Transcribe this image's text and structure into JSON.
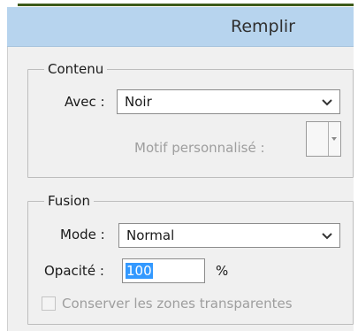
{
  "window": {
    "title": "Remplir"
  },
  "contenu": {
    "legend": "Contenu",
    "avec_label": "Avec :",
    "avec_value": "Noir",
    "motif_label": "Motif personnalisé :"
  },
  "fusion": {
    "legend": "Fusion",
    "mode_label": "Mode :",
    "mode_value": "Normal",
    "opacite_label": "Opacité :",
    "opacite_value": "100",
    "opacite_unit": "%",
    "conserver_label": "Conserver les zones transparentes",
    "conserver_checked": false
  },
  "colors": {
    "titlebar": "#b7d4ee",
    "accent_line": "#3d5b1a",
    "selection": "#3399ff",
    "disabled_text": "#9e9e9e"
  }
}
